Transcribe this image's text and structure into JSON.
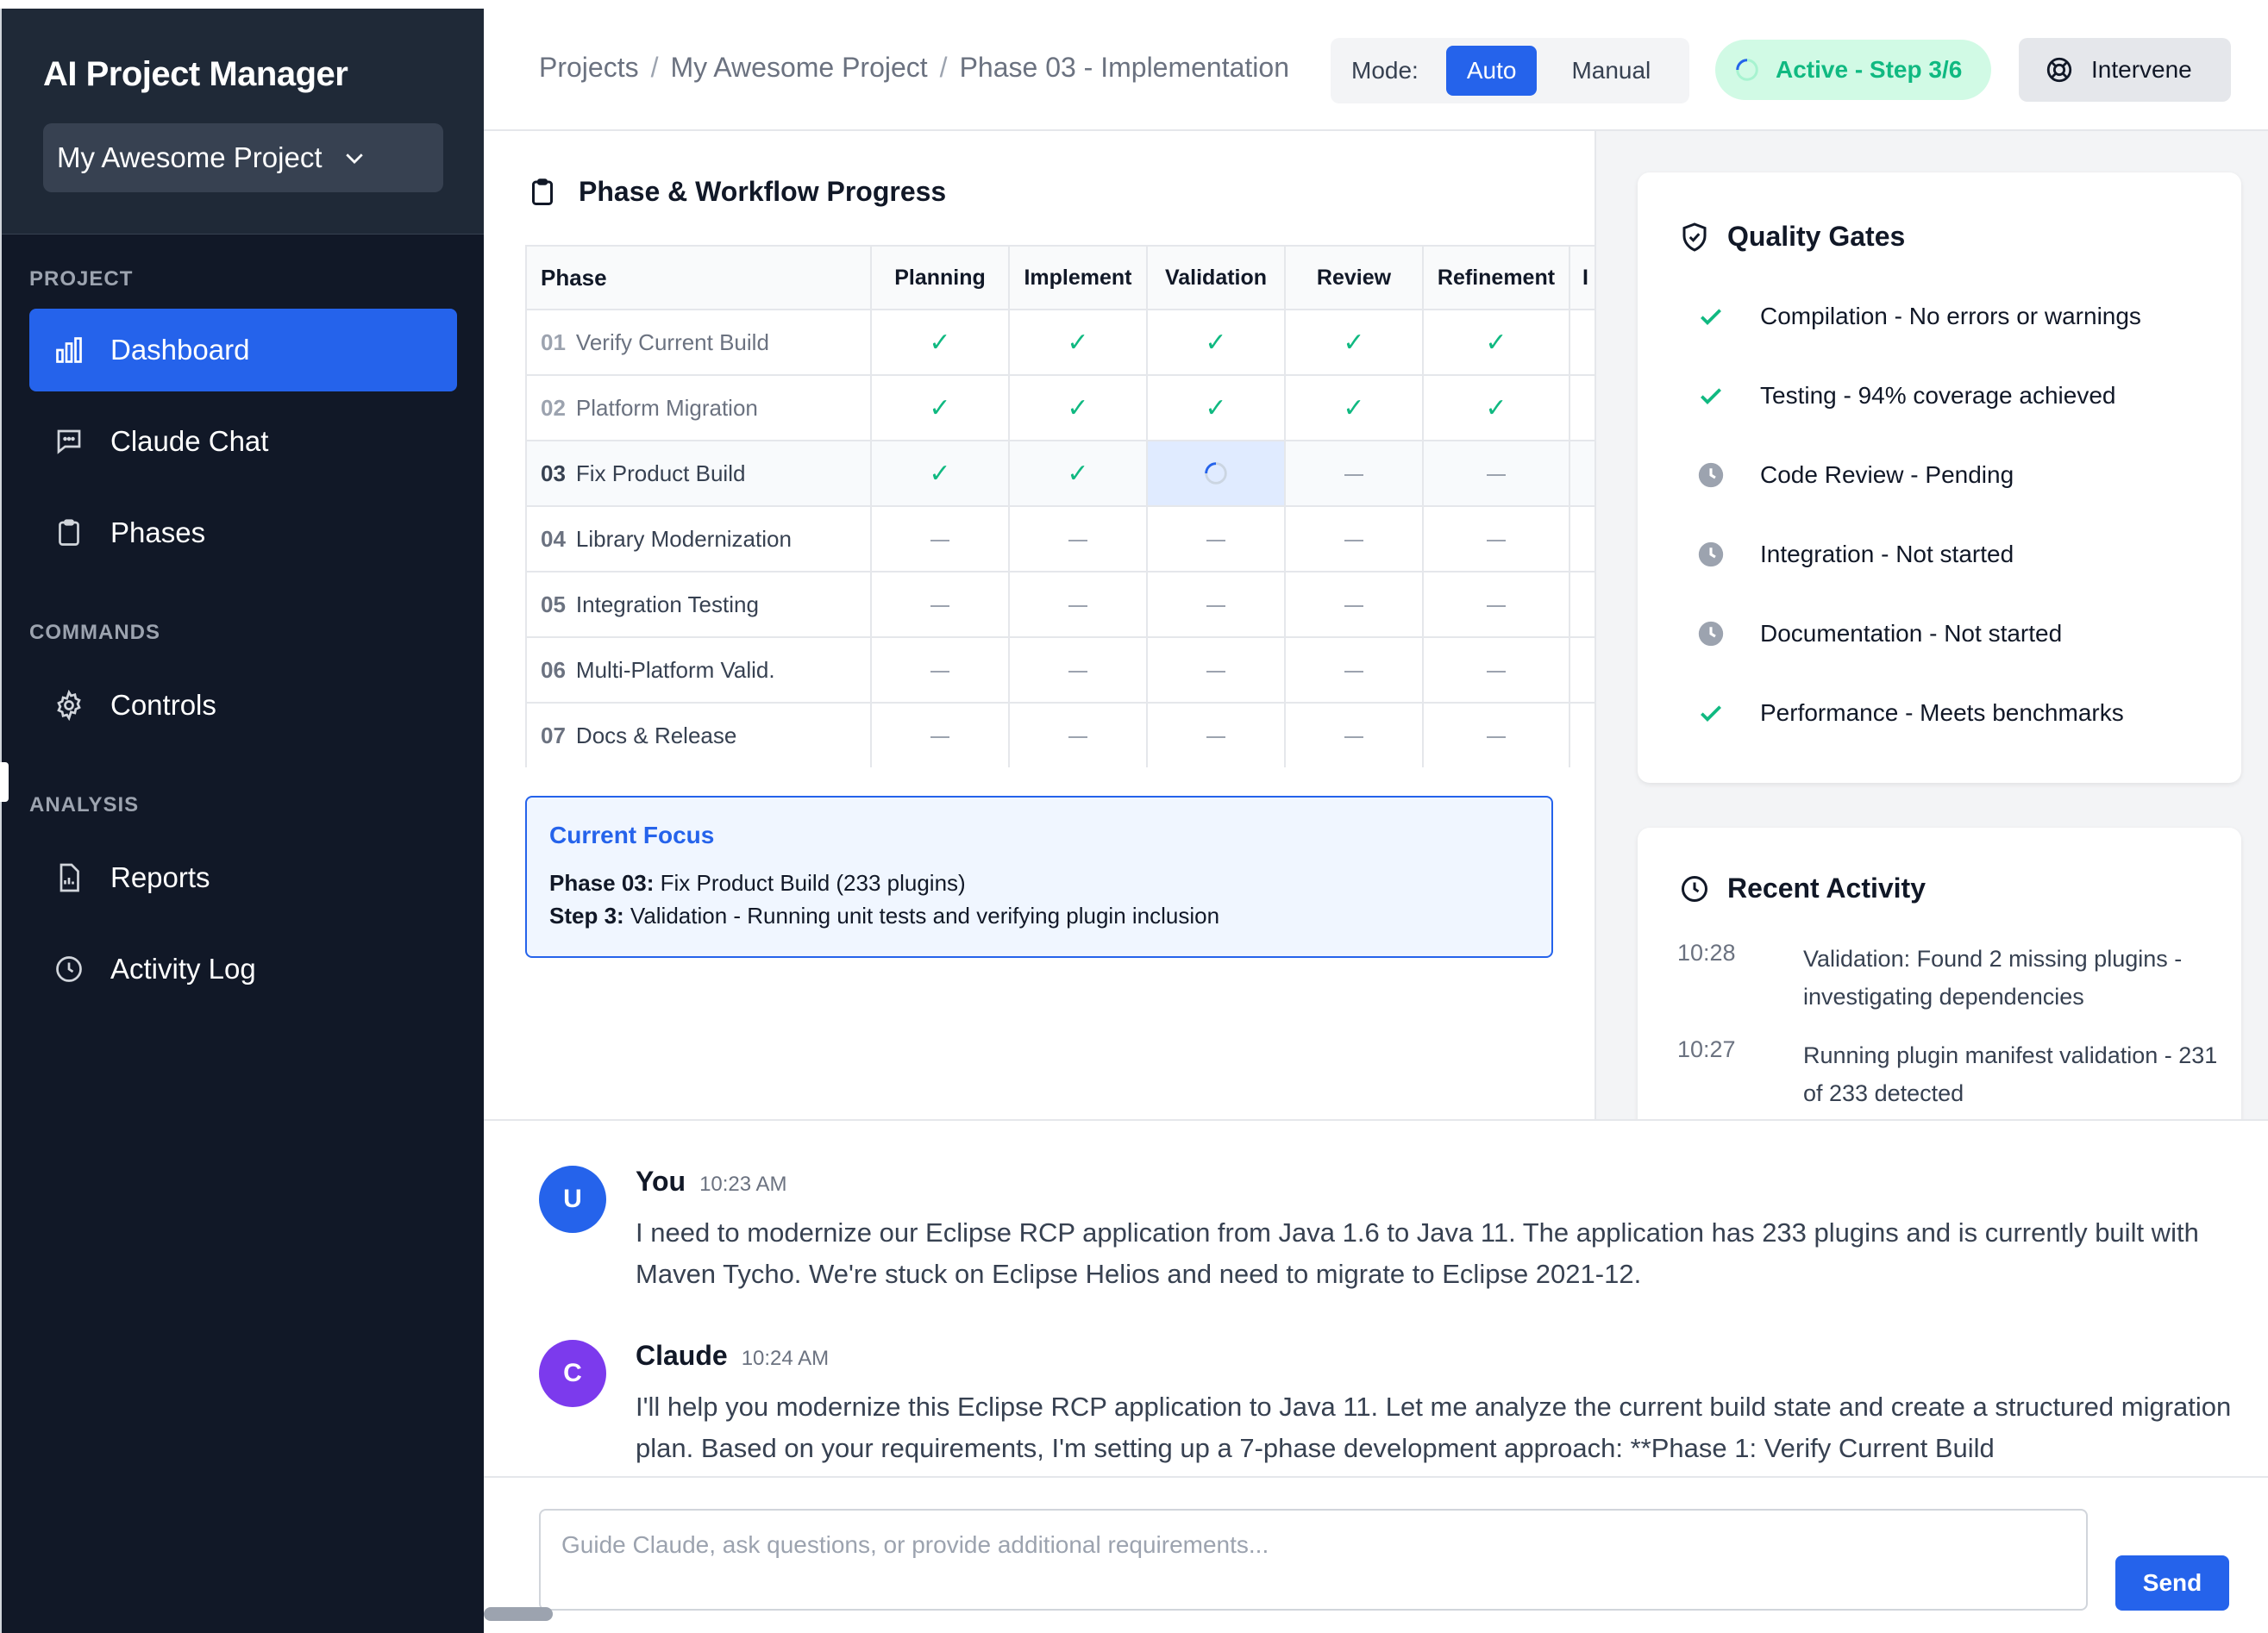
{
  "app": {
    "title": "AI Project Manager"
  },
  "project_selector": {
    "value": "My Awesome Project"
  },
  "sidebar": {
    "sections": [
      {
        "label": "PROJECT"
      },
      {
        "label": "COMMANDS"
      },
      {
        "label": "ANALYSIS"
      }
    ],
    "items": [
      {
        "label": "Dashboard",
        "icon": "bar-chart-icon",
        "active": true
      },
      {
        "label": "Claude Chat",
        "icon": "chat-icon"
      },
      {
        "label": "Phases",
        "icon": "clipboard-icon"
      },
      {
        "label": "Controls",
        "icon": "gear-icon"
      },
      {
        "label": "Reports",
        "icon": "report-icon"
      },
      {
        "label": "Activity Log",
        "icon": "clock-icon"
      }
    ]
  },
  "header": {
    "breadcrumb": [
      "Projects",
      "My Awesome Project",
      "Phase 03 - Implementation"
    ],
    "mode_label": "Mode:",
    "mode_options": [
      "Auto",
      "Manual"
    ],
    "mode_selected": "Auto",
    "status": "Active - Step 3/6",
    "intervene_label": "Intervene"
  },
  "workflow": {
    "title": "Phase & Workflow Progress",
    "columns": [
      "Phase",
      "Planning",
      "Implement",
      "Validation",
      "Review",
      "Refinement",
      "I"
    ],
    "rows": [
      {
        "num": "01",
        "name": "Verify Current Build",
        "steps": [
          "done",
          "done",
          "done",
          "done",
          "done"
        ]
      },
      {
        "num": "02",
        "name": "Platform Migration",
        "steps": [
          "done",
          "done",
          "done",
          "done",
          "done"
        ]
      },
      {
        "num": "03",
        "name": "Fix Product Build",
        "steps": [
          "done",
          "done",
          "running",
          "pending",
          "pending"
        ]
      },
      {
        "num": "04",
        "name": "Library Modernization",
        "steps": [
          "pending",
          "pending",
          "pending",
          "pending",
          "pending"
        ]
      },
      {
        "num": "05",
        "name": "Integration Testing",
        "steps": [
          "pending",
          "pending",
          "pending",
          "pending",
          "pending"
        ]
      },
      {
        "num": "06",
        "name": "Multi-Platform Valid.",
        "steps": [
          "pending",
          "pending",
          "pending",
          "pending",
          "pending"
        ]
      },
      {
        "num": "07",
        "name": "Docs & Release",
        "steps": [
          "pending",
          "pending",
          "pending",
          "pending",
          "pending"
        ]
      }
    ]
  },
  "focus": {
    "title": "Current Focus",
    "phase_label": "Phase 03:",
    "phase_text": " Fix Product Build (233 plugins)",
    "step_label": "Step 3:",
    "step_text": " Validation - Running unit tests and verifying plugin inclusion"
  },
  "quality_gates": {
    "title": "Quality Gates",
    "items": [
      {
        "label": "Compilation - No errors or warnings",
        "status": "pass"
      },
      {
        "label": "Testing - 94% coverage achieved",
        "status": "pass"
      },
      {
        "label": "Code Review - Pending",
        "status": "pending"
      },
      {
        "label": "Integration - Not started",
        "status": "pending"
      },
      {
        "label": "Documentation - Not started",
        "status": "pending"
      },
      {
        "label": "Performance - Meets benchmarks",
        "status": "pass"
      }
    ]
  },
  "recent_activity": {
    "title": "Recent Activity",
    "items": [
      {
        "time": "10:28",
        "text": "Validation: Found 2 missing plugins - investigating dependencies"
      },
      {
        "time": "10:27",
        "text": "Running plugin manifest validation - 231 of 233 detected"
      }
    ]
  },
  "chat": {
    "messages": [
      {
        "initial": "U",
        "name": "You",
        "time": "10:23 AM",
        "text": "I need to modernize our Eclipse RCP application from Java 1.6 to Java 11. The application has 233 plugins and is currently built with Maven Tycho. We're stuck on Eclipse Helios and need to migrate to Eclipse 2021-12."
      },
      {
        "initial": "C",
        "name": "Claude",
        "time": "10:24 AM",
        "text": "I'll help you modernize this Eclipse RCP application to Java 11. Let me analyze the current build state and create a structured migration plan. Based on your requirements, I'm setting up a 7-phase development approach: **Phase 1: Verify Current Build"
      }
    ],
    "input_placeholder": "Guide Claude, ask questions, or provide additional requirements...",
    "send_label": "Send"
  },
  "colors": {
    "accent": "#2563eb",
    "success": "#10b981",
    "sidebar_bg": "#111827",
    "user_avatar": "#2563eb",
    "claude_avatar": "#7c3aed"
  }
}
